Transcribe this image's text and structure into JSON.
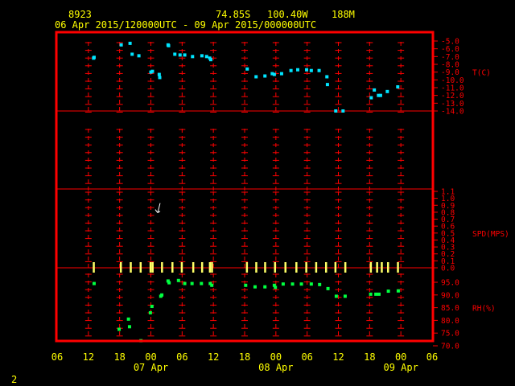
{
  "header": {
    "station": "8923",
    "latitude": "74.85S",
    "longitude": "100.40W",
    "elevation": "188M",
    "time_range": "06 Apr 2015/120000UTC - 09 Apr 2015/000000UTC"
  },
  "footer": {
    "page_number": "2"
  },
  "colors": {
    "background": "#000000",
    "frame": "#ff0000",
    "grid": "#ff0000",
    "axis_text": "#ffff00",
    "label_text": "#ff0000",
    "temperature": "#00e5ff",
    "wind": "#ffff66",
    "humidity": "#00ff40"
  },
  "chart_data": {
    "type": "scatter",
    "x_axis": {
      "unit": "hours since 06 Apr 2015 00 UTC",
      "range": [
        6,
        78
      ],
      "tick_labels": [
        "06",
        "12",
        "18",
        "00",
        "06",
        "12",
        "18",
        "00",
        "06",
        "12",
        "18",
        "00",
        "06"
      ],
      "day_labels": [
        {
          "label": "07 Apr",
          "at": 24
        },
        {
          "label": "08 Apr",
          "at": 48
        },
        {
          "label": "09 Apr",
          "at": 72
        }
      ]
    },
    "panels": [
      {
        "name": "temperature",
        "label": "T(C)",
        "ylim": [
          -14.0,
          -5.0
        ],
        "tick_labels": [
          "-5.0",
          "-6.0",
          "-7.0",
          "-8.0",
          "-9.0",
          "-10.0",
          "-11.0",
          "-12.0",
          "-13.0",
          "-14.0"
        ],
        "points": [
          [
            13,
            -7.2
          ],
          [
            13.1,
            -7.1
          ],
          [
            18.3,
            -5.5
          ],
          [
            20,
            -5.3
          ],
          [
            20.4,
            -6.7
          ],
          [
            21.7,
            -6.9
          ],
          [
            24,
            -9.0
          ],
          [
            24.3,
            -8.9
          ],
          [
            25.6,
            -9.3
          ],
          [
            25.7,
            -9.7
          ],
          [
            27.3,
            -5.5
          ],
          [
            27.4,
            -5.6
          ],
          [
            28.6,
            -6.7
          ],
          [
            29.6,
            -6.8
          ],
          [
            30.5,
            -6.8
          ],
          [
            32,
            -7.0
          ],
          [
            33.8,
            -6.9
          ],
          [
            34.7,
            -7.0
          ],
          [
            35.3,
            -7.2
          ],
          [
            35.5,
            -7.4
          ],
          [
            42.5,
            -8.6
          ],
          [
            44.2,
            -9.6
          ],
          [
            45.9,
            -9.5
          ],
          [
            47.3,
            -9.2
          ],
          [
            47.7,
            -9.3
          ],
          [
            49.1,
            -9.2
          ],
          [
            50.9,
            -8.8
          ],
          [
            52.2,
            -8.7
          ],
          [
            53.9,
            -8.7
          ],
          [
            54.8,
            -8.8
          ],
          [
            56.3,
            -8.8
          ],
          [
            57.8,
            -9.6
          ],
          [
            57.9,
            -10.6
          ],
          [
            59.5,
            -14.0
          ],
          [
            60.9,
            -14.0
          ],
          [
            66.3,
            -12.3
          ],
          [
            66.9,
            -11.3
          ],
          [
            67.7,
            -12.0
          ],
          [
            68.1,
            -12.0
          ],
          [
            69.4,
            -11.5
          ],
          [
            71.4,
            -10.9
          ]
        ]
      },
      {
        "name": "wind_speed",
        "label": "SPD(MPS)",
        "ylim": [
          0.0,
          1.1
        ],
        "tick_labels": [
          "1.1",
          "1.0",
          "0.9",
          "0.8",
          "0.7",
          "0.6",
          "0.5",
          "0.4",
          "0.3",
          "0.2",
          "0.1",
          "0.0"
        ],
        "calm_marks_at": [
          13,
          18.2,
          20.1,
          22,
          23.9,
          24.3,
          26.1,
          28.1,
          29.9,
          32.1,
          33.8,
          35.3,
          35.7,
          42.4,
          44.2,
          45.9,
          47.8,
          49.8,
          51.9,
          53.8,
          55.7,
          57.6,
          59.4,
          61.3,
          66.2,
          67.4,
          68.3,
          69.5,
          71.4
        ],
        "arrow": {
          "x": 25,
          "speed": 0.85
        }
      },
      {
        "name": "relative_humidity",
        "label": "RH(%)",
        "ylim": [
          70.0,
          95.0
        ],
        "tick_labels": [
          "95.0",
          "90.0",
          "85.0",
          "80.0",
          "75.0",
          "70.0"
        ],
        "points": [
          [
            13.1,
            94.5
          ],
          [
            17.9,
            76.5
          ],
          [
            19.7,
            80.5
          ],
          [
            19.9,
            77.5
          ],
          [
            22.1,
            72.0
          ],
          [
            23.9,
            83.0
          ],
          [
            24.2,
            85.5
          ],
          [
            25.9,
            89.5
          ],
          [
            26.1,
            90.0
          ],
          [
            27.3,
            95.5
          ],
          [
            27.5,
            94.8
          ],
          [
            29.3,
            95.7
          ],
          [
            30.5,
            94.5
          ],
          [
            31.9,
            94.5
          ],
          [
            33.7,
            94.5
          ],
          [
            35.4,
            94.5
          ],
          [
            35.7,
            93.8
          ],
          [
            42.2,
            93.8
          ],
          [
            44.0,
            93.2
          ],
          [
            45.9,
            93.2
          ],
          [
            47.7,
            93.8
          ],
          [
            47.9,
            93.0
          ],
          [
            49.4,
            94.3
          ],
          [
            51.2,
            94.3
          ],
          [
            52.9,
            94.3
          ],
          [
            54.8,
            94.3
          ],
          [
            56.4,
            94.1
          ],
          [
            58.0,
            92.5
          ],
          [
            59.6,
            89.5
          ],
          [
            61.3,
            89.5
          ],
          [
            66.2,
            90.3
          ],
          [
            67.2,
            90.3
          ],
          [
            67.8,
            90.3
          ],
          [
            69.6,
            91.5
          ],
          [
            71.5,
            91.6
          ]
        ]
      }
    ]
  }
}
